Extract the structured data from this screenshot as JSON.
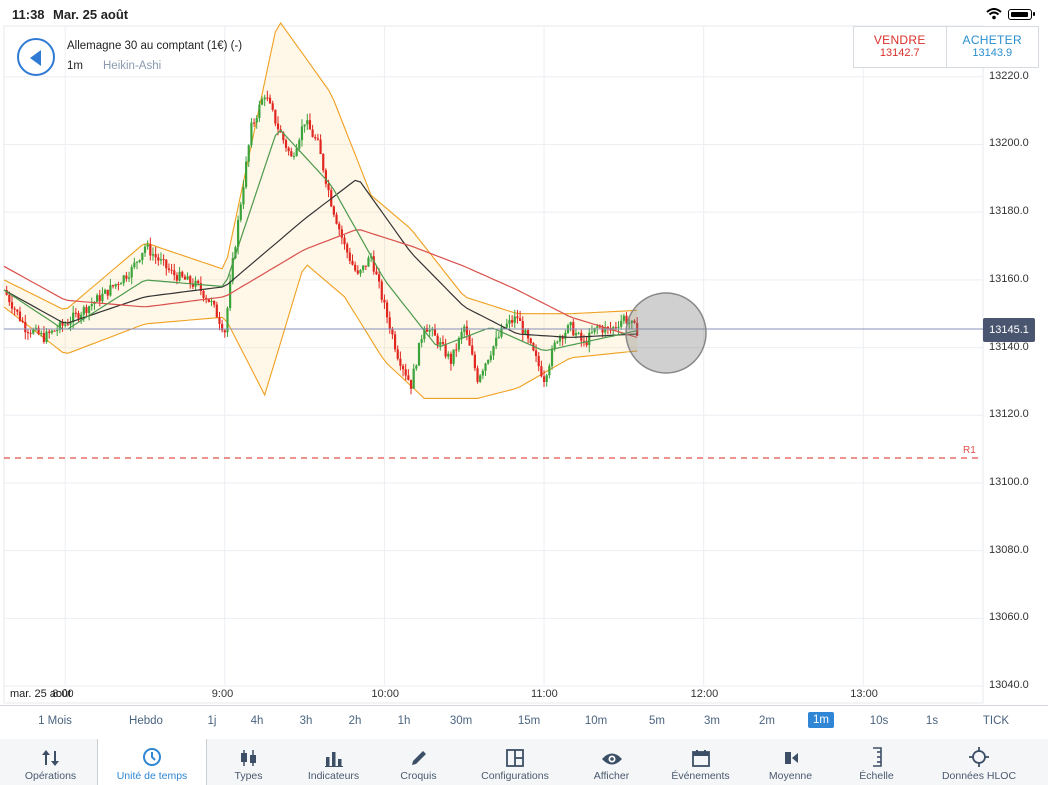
{
  "status_bar": {
    "time": "11:38",
    "date": "Mar. 25 août"
  },
  "instrument": {
    "title": "Allemagne 30 au comptant (1€) (-)",
    "timeframe": "1m",
    "chart_type": "Heikin-Ashi"
  },
  "trade": {
    "sell_label": "VENDRE",
    "sell_price": "13142.7",
    "buy_label": "ACHETER",
    "buy_price": "13143.9"
  },
  "colors": {
    "sell": "#d9302b",
    "buy": "#2a8fcf",
    "up_candle": "#3aa33a",
    "down_candle": "#e0261f",
    "bollinger": "#f0a020",
    "ma_black": "#333333",
    "ma_red": "#d9504c",
    "ma_green": "#4c9a4c",
    "accent": "#2f86d4"
  },
  "chart": {
    "current_price": "13145.1",
    "resistance": {
      "label": "R1",
      "value": 13105
    },
    "date_label": "mar. 25 août",
    "y_ticks": [
      "13220.0",
      "13200.0",
      "13180.0",
      "13160.0",
      "13140.0",
      "13120.0",
      "13100.0",
      "13080.0",
      "13060.0",
      "13040.0"
    ],
    "x_ticks": [
      "8:00",
      "9:00",
      "10:00",
      "11:00",
      "12:00",
      "13:00"
    ]
  },
  "chart_data": {
    "type": "candlestick",
    "ylim": [
      13035,
      13235
    ],
    "x_range": [
      "7:37",
      "13:45"
    ],
    "y_ticks": [
      13220,
      13200,
      13180,
      13160,
      13140,
      13120,
      13100,
      13080,
      13060,
      13040
    ],
    "x_ticks": [
      "8:00",
      "9:00",
      "10:00",
      "11:00",
      "12:00",
      "13:00"
    ],
    "price_path": [
      [
        "7:37",
        13157
      ],
      [
        "7:45",
        13146
      ],
      [
        "7:52",
        13143
      ],
      [
        "8:00",
        13147
      ],
      [
        "8:05",
        13150
      ],
      [
        "8:15",
        13156
      ],
      [
        "8:25",
        13163
      ],
      [
        "8:30",
        13170
      ],
      [
        "8:40",
        13162
      ],
      [
        "8:50",
        13158
      ],
      [
        "8:55",
        13153
      ],
      [
        "9:00",
        13145
      ],
      [
        "9:03",
        13165
      ],
      [
        "9:06",
        13183
      ],
      [
        "9:10",
        13205
      ],
      [
        "9:15",
        13215
      ],
      [
        "9:20",
        13205
      ],
      [
        "9:25",
        13196
      ],
      [
        "9:30",
        13207
      ],
      [
        "9:35",
        13200
      ],
      [
        "9:40",
        13183
      ],
      [
        "9:45",
        13170
      ],
      [
        "9:50",
        13161
      ],
      [
        "9:55",
        13167
      ],
      [
        "10:00",
        13152
      ],
      [
        "10:05",
        13138
      ],
      [
        "10:10",
        13129
      ],
      [
        "10:15",
        13147
      ],
      [
        "10:20",
        13142
      ],
      [
        "10:25",
        13136
      ],
      [
        "10:30",
        13146
      ],
      [
        "10:35",
        13131
      ],
      [
        "10:40",
        13139
      ],
      [
        "10:45",
        13146
      ],
      [
        "10:50",
        13149
      ],
      [
        "10:55",
        13140
      ],
      [
        "11:00",
        13131
      ],
      [
        "11:05",
        13143
      ],
      [
        "11:10",
        13146
      ],
      [
        "11:15",
        13141
      ],
      [
        "11:20",
        13146
      ],
      [
        "11:25",
        13145
      ],
      [
        "11:30",
        13149
      ],
      [
        "11:35",
        13145
      ]
    ],
    "series": [
      {
        "type": "ma",
        "color": "#333333",
        "points": [
          [
            "7:37",
            13157
          ],
          [
            "8:00",
            13147
          ],
          [
            "8:30",
            13155
          ],
          [
            "9:00",
            13158
          ],
          [
            "9:30",
            13178
          ],
          [
            "9:50",
            13190
          ],
          [
            "10:10",
            13168
          ],
          [
            "10:30",
            13152
          ],
          [
            "10:50",
            13144
          ],
          [
            "11:10",
            13143
          ],
          [
            "11:35",
            13144
          ]
        ]
      },
      {
        "type": "ma",
        "color": "#d9504c",
        "points": [
          [
            "7:37",
            13164
          ],
          [
            "8:00",
            13154
          ],
          [
            "8:30",
            13152
          ],
          [
            "9:00",
            13155
          ],
          [
            "9:30",
            13169
          ],
          [
            "9:50",
            13175
          ],
          [
            "10:10",
            13170
          ],
          [
            "10:30",
            13164
          ],
          [
            "10:50",
            13157
          ],
          [
            "11:10",
            13149
          ],
          [
            "11:35",
            13143
          ]
        ]
      },
      {
        "type": "ma",
        "color": "#4c9a4c",
        "points": [
          [
            "7:37",
            13157
          ],
          [
            "8:00",
            13145
          ],
          [
            "8:30",
            13160
          ],
          [
            "9:00",
            13158
          ],
          [
            "9:20",
            13205
          ],
          [
            "9:40",
            13188
          ],
          [
            "10:00",
            13160
          ],
          [
            "10:20",
            13140
          ],
          [
            "10:40",
            13146
          ],
          [
            "11:00",
            13139
          ],
          [
            "11:35",
            13145
          ]
        ]
      },
      {
        "type": "band_upper",
        "color": "#f0a020",
        "points": [
          [
            "7:37",
            13160
          ],
          [
            "8:00",
            13151
          ],
          [
            "8:30",
            13171
          ],
          [
            "9:00",
            13163
          ],
          [
            "9:20",
            13237
          ],
          [
            "9:40",
            13215
          ],
          [
            "9:55",
            13185
          ],
          [
            "10:10",
            13175
          ],
          [
            "10:30",
            13155
          ],
          [
            "10:50",
            13150
          ],
          [
            "11:10",
            13150
          ],
          [
            "11:35",
            13151
          ]
        ]
      },
      {
        "type": "band_lower",
        "color": "#f0a020",
        "points": [
          [
            "7:37",
            13152
          ],
          [
            "8:00",
            13138
          ],
          [
            "8:30",
            13147
          ],
          [
            "9:00",
            13149
          ],
          [
            "9:15",
            13126
          ],
          [
            "9:30",
            13165
          ],
          [
            "9:45",
            13155
          ],
          [
            "10:00",
            13136
          ],
          [
            "10:15",
            13125
          ],
          [
            "10:35",
            13125
          ],
          [
            "10:50",
            13128
          ],
          [
            "11:10",
            13137
          ],
          [
            "11:35",
            13139
          ]
        ]
      }
    ]
  },
  "timeframes": [
    "1 Mois",
    "Hebdo",
    "1j",
    "4h",
    "3h",
    "2h",
    "1h",
    "30m",
    "15m",
    "10m",
    "5m",
    "3m",
    "2m",
    "1m",
    "10s",
    "1s",
    "TICK"
  ],
  "active_timeframe": "1m",
  "toolbar": [
    {
      "label": "Opérations",
      "icon": "arrows-updown-icon"
    },
    {
      "label": "Unité de temps",
      "icon": "clock-icon"
    },
    {
      "label": "Types",
      "icon": "candles-icon"
    },
    {
      "label": "Indicateurs",
      "icon": "bar-chart-icon"
    },
    {
      "label": "Croquis",
      "icon": "pencil-icon"
    },
    {
      "label": "Configurations",
      "icon": "layout-icon"
    },
    {
      "label": "Afficher",
      "icon": "eye-icon"
    },
    {
      "label": "Événements",
      "icon": "calendar-icon"
    },
    {
      "label": "Moyenne",
      "icon": "moyenne-icon"
    },
    {
      "label": "Échelle",
      "icon": "scale-icon"
    },
    {
      "label": "Données HLOC",
      "icon": "crosshair-icon"
    }
  ]
}
